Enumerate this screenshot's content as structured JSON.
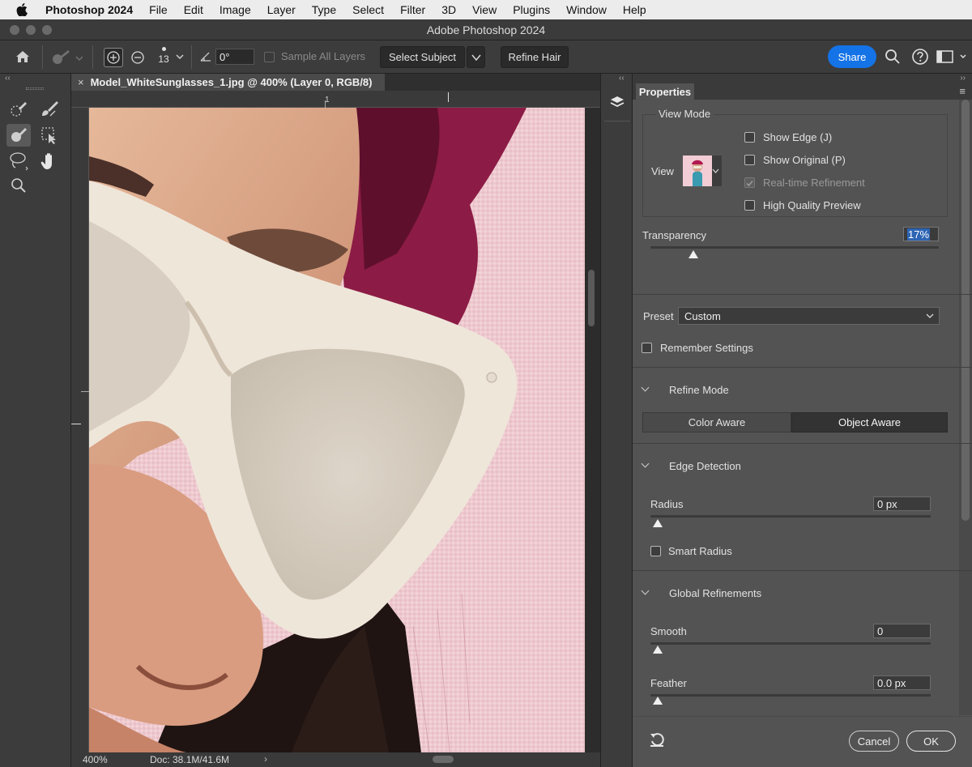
{
  "menubar": {
    "app_name": "Photoshop 2024",
    "items": [
      "File",
      "Edit",
      "Image",
      "Layer",
      "Type",
      "Select",
      "Filter",
      "3D",
      "View",
      "Plugins",
      "Window",
      "Help"
    ]
  },
  "window": {
    "title": "Adobe Photoshop 2024"
  },
  "options_bar": {
    "brush_size": "13",
    "angle_value": "0°",
    "sample_all_layers_label": "Sample All Layers",
    "select_subject_label": "Select Subject",
    "refine_hair_label": "Refine Hair",
    "share_label": "Share"
  },
  "document": {
    "tab_title": "Model_WhiteSunglasses_1.jpg @ 400% (Layer 0, RGB/8)",
    "ruler_mark": "1"
  },
  "status": {
    "zoom": "400%",
    "doc_info": "Doc: 38.1M/41.6M"
  },
  "properties": {
    "tab_label": "Properties",
    "view_mode": {
      "heading": "View Mode",
      "view_label": "View",
      "show_edge_label": "Show Edge (J)",
      "show_original_label": "Show Original (P)",
      "realtime_label": "Real-time Refinement",
      "hq_preview_label": "High Quality Preview"
    },
    "transparency": {
      "label": "Transparency",
      "value": "17%",
      "level": 0.17
    },
    "preset": {
      "label": "Preset",
      "value": "Custom"
    },
    "remember_settings_label": "Remember Settings",
    "refine_mode": {
      "heading": "Refine Mode",
      "options": [
        "Color Aware",
        "Object Aware"
      ],
      "selected": "Object Aware"
    },
    "edge_detection": {
      "heading": "Edge Detection",
      "radius_label": "Radius",
      "radius_value": "0 px",
      "smart_radius_label": "Smart Radius"
    },
    "global_refinements": {
      "heading": "Global Refinements",
      "smooth_label": "Smooth",
      "smooth_value": "0",
      "feather_label": "Feather",
      "feather_value": "0.0 px"
    },
    "cancel_label": "Cancel",
    "ok_label": "OK"
  },
  "colors": {
    "accent": "#1473e6",
    "canvas_background": "#f1cfd4",
    "panel": "#535353"
  }
}
